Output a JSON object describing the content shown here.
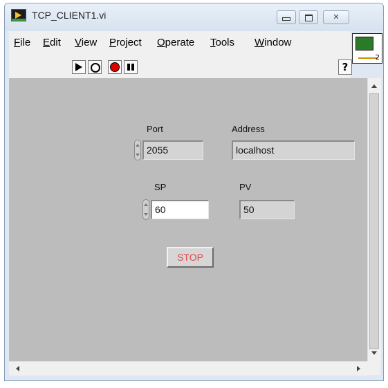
{
  "window": {
    "title": "TCP_CLIENT1.vi",
    "icon": "labview-vi-icon"
  },
  "menu": {
    "items": [
      "File",
      "Edit",
      "View",
      "Project",
      "Operate",
      "Tools",
      "Window"
    ]
  },
  "toolbar": {
    "help_glyph": "?"
  },
  "vi_icon": {
    "number": "2"
  },
  "panel": {
    "port": {
      "label": "Port",
      "value": "2055"
    },
    "address": {
      "label": "Address",
      "value": "localhost"
    },
    "sp": {
      "label": "SP",
      "value": "60"
    },
    "pv": {
      "label": "PV",
      "value": "50"
    },
    "stop_label": "STOP"
  },
  "colors": {
    "panel_bg": "#bcbcbc",
    "stop_text": "#e14a4a",
    "abort_red": "#dd0000"
  }
}
